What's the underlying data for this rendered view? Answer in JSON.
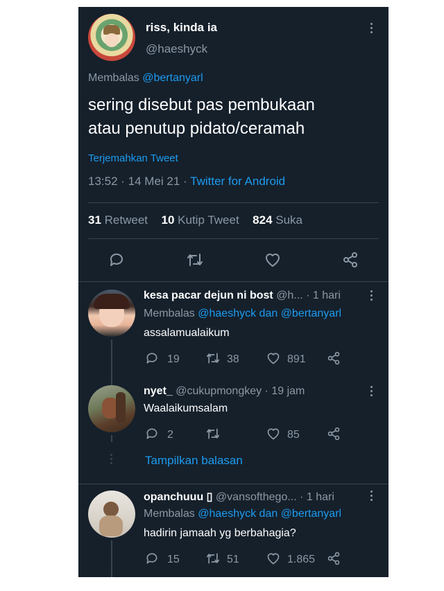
{
  "tweet": {
    "display_name": "riss, kinda ia",
    "handle": "@haeshyck",
    "replying_prefix": "Membalas",
    "replying_to": "@bertanyarl",
    "text_line1": "sering disebut pas pembukaan",
    "text_line2": "atau penutup pidato/ceramah",
    "translate_label": "Terjemahkan Tweet",
    "timestamp": "13:52 · 14 Mei 21 ·",
    "source": "Twitter for Android",
    "retweets_count": "31",
    "retweets_label": "Retweet",
    "quotes_count": "10",
    "quotes_label": "Kutip Tweet",
    "likes_count": "824",
    "likes_label": "Suka"
  },
  "replies": [
    {
      "display_name": "kesa pacar dejun ni bost",
      "handle_time": "@h... · 1 hari",
      "replying_prefix": "Membalas",
      "replying_to": "@haeshyck dan @bertanyarl",
      "text": "assalamualaikum",
      "replies": "19",
      "retweets": "38",
      "likes": "891"
    },
    {
      "display_name": "nyet_",
      "handle_time": "@cukupmongkey · 19 jam",
      "text": "Waalaikumsalam",
      "replies": "2",
      "retweets": "",
      "likes": "85"
    },
    {
      "display_name": "opanchuuu ▯",
      "handle_time": "@vansofthego... · 1 hari",
      "replying_prefix": "Membalas",
      "replying_to": "@haeshyck dan @bertanyarl",
      "text": "hadirin jamaah yg berbahagia?",
      "replies": "15",
      "retweets": "51",
      "likes": "1.865"
    }
  ],
  "show_replies_label": "Tampilkan balasan",
  "colors": {
    "background": "#15202b",
    "link": "#1d9bf0",
    "muted": "#8b98a5",
    "text": "#d9d9d9"
  }
}
